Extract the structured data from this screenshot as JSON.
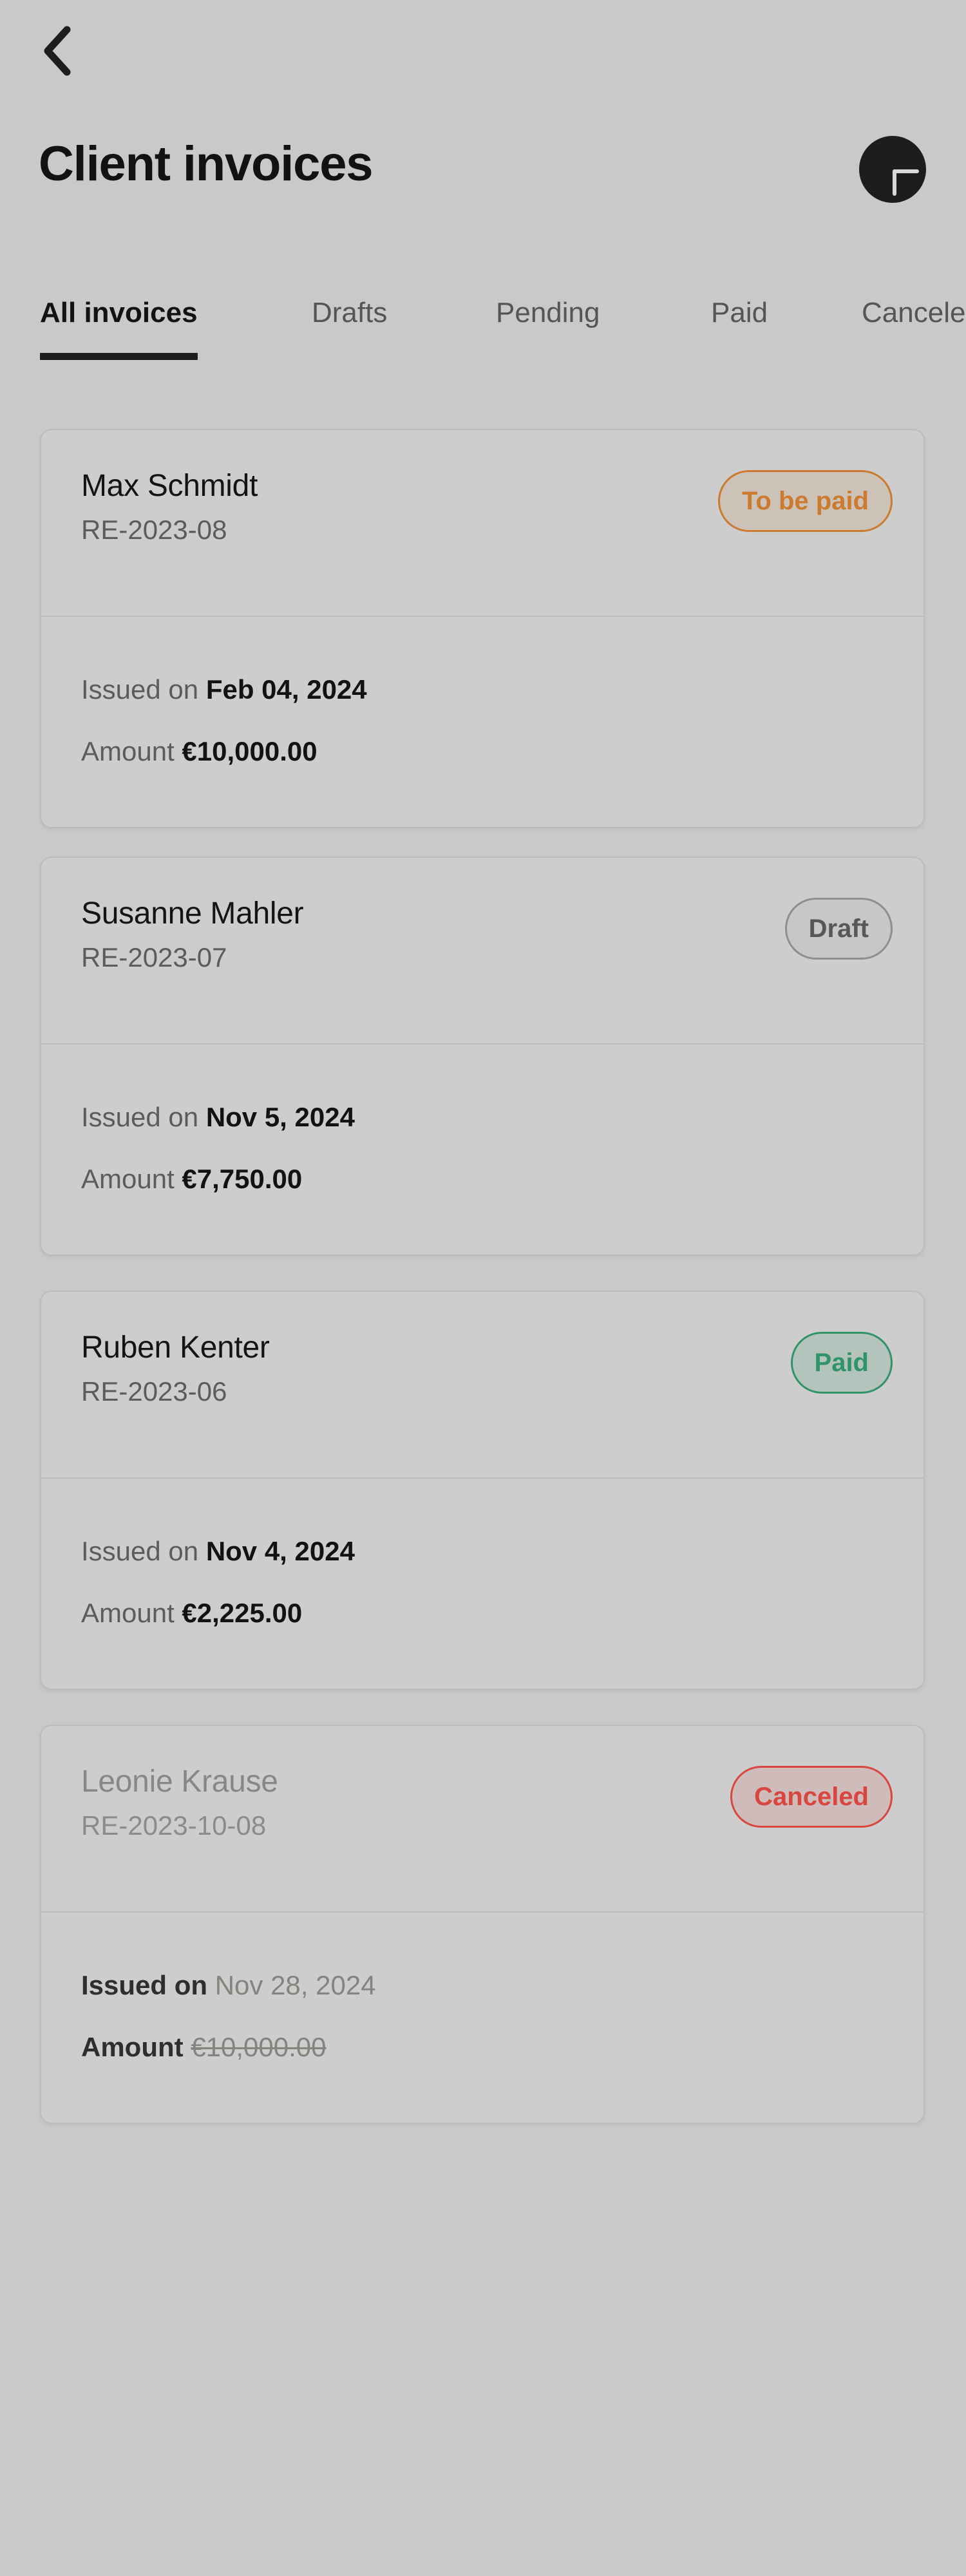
{
  "header": {
    "back_icon": "chevron-left-icon",
    "title": "Client invoices",
    "add_icon": "plus-icon"
  },
  "tabs": [
    {
      "label": "All invoices",
      "active": true
    },
    {
      "label": "Drafts",
      "active": false
    },
    {
      "label": "Pending",
      "active": false
    },
    {
      "label": "Paid",
      "active": false
    },
    {
      "label": "Canceled",
      "active": false
    }
  ],
  "labels": {
    "issued_on": "Issued on",
    "amount": "Amount"
  },
  "colors": {
    "background": "#c9c9c9",
    "card": "#cdcdcd",
    "card_border": "#bcbcbc",
    "text_primary": "#121212",
    "text_secondary": "#5c5c5a",
    "accent_dark": "#1d1d1d",
    "status_pending": "#cc7a2e",
    "status_draft": "#575756",
    "status_paid": "#2f9468",
    "status_canceled": "#d8463f"
  },
  "invoices": [
    {
      "client": "Max Schmidt",
      "number": "RE-2023-08",
      "status": "To be paid",
      "status_kind": "pending",
      "issued_on": "Feb 04, 2024",
      "amount": "€10,000.00",
      "canceled": false
    },
    {
      "client": "Susanne Mahler",
      "number": "RE-2023-07",
      "status": "Draft",
      "status_kind": "draft",
      "issued_on": "Nov 5, 2024",
      "amount": "€7,750.00",
      "canceled": false
    },
    {
      "client": "Ruben Kenter",
      "number": "RE-2023-06",
      "status": "Paid",
      "status_kind": "paid",
      "issued_on": "Nov 4, 2024",
      "amount": "€2,225.00",
      "canceled": false
    },
    {
      "client": "Leonie Krause",
      "number": "RE-2023-10-08",
      "status": "Canceled",
      "status_kind": "canceled",
      "issued_on": "Nov 28, 2024",
      "amount": "€10,000.00",
      "canceled": true
    }
  ]
}
